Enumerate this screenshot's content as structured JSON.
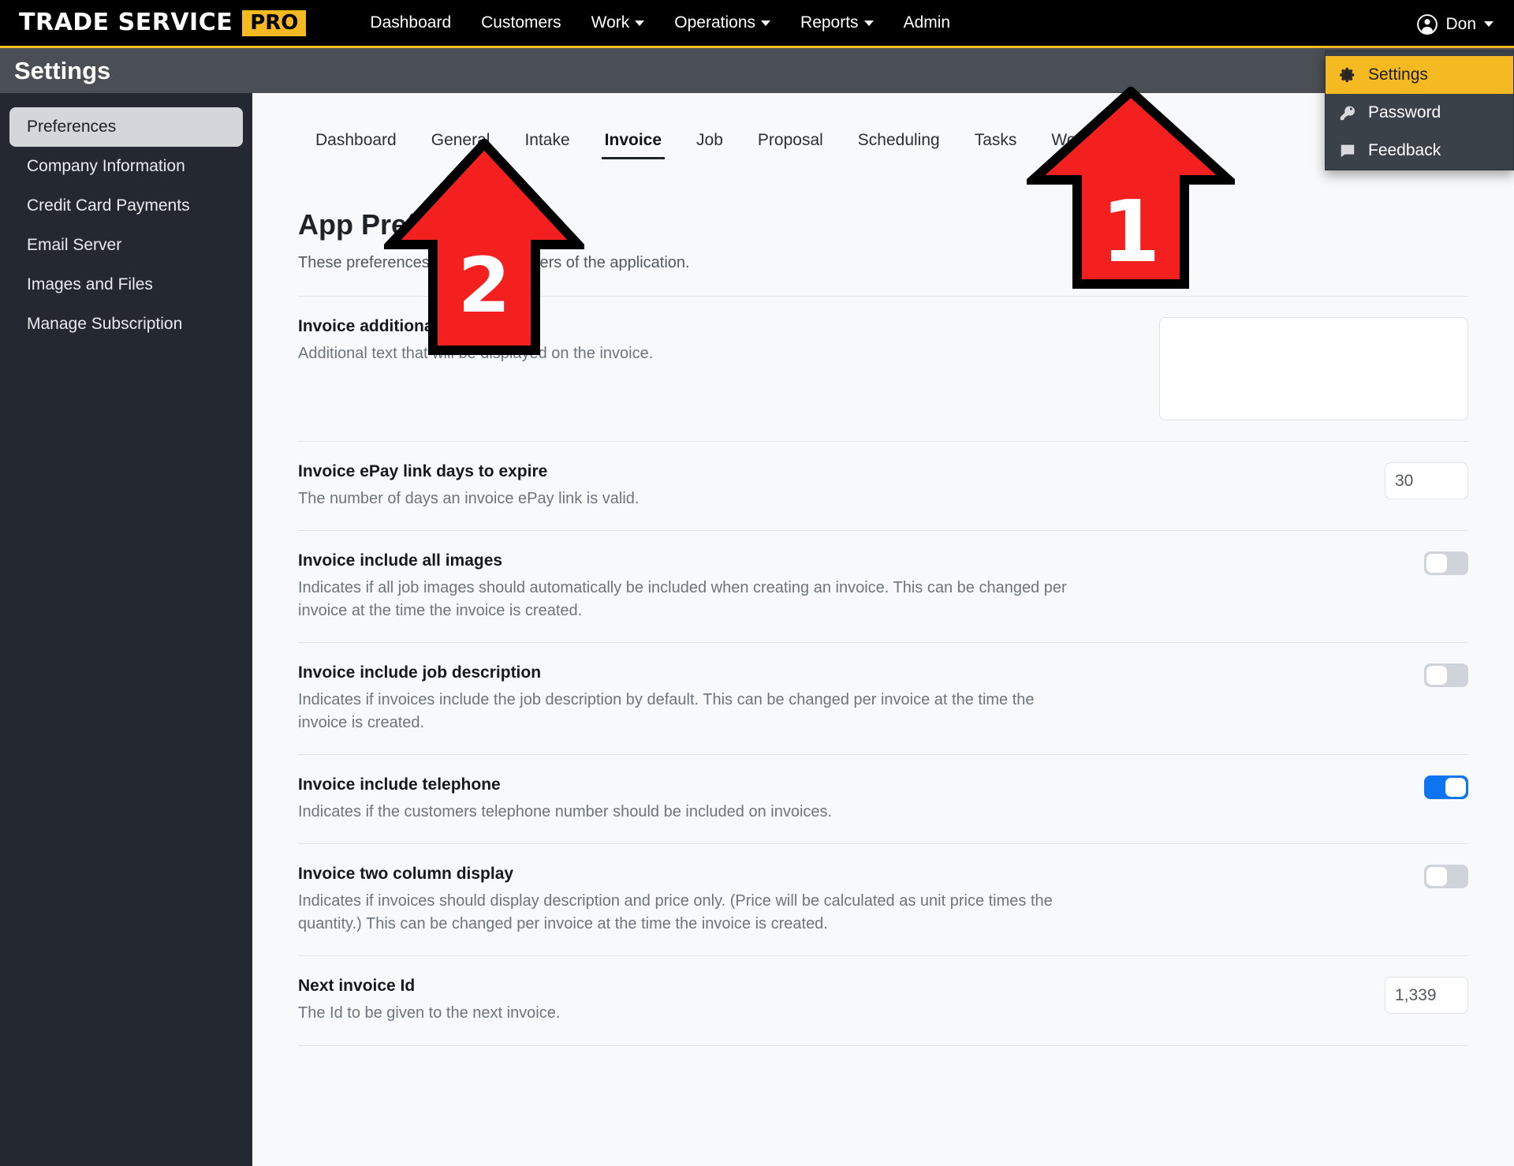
{
  "navbar": {
    "brand_main": "TRADE SERVICE",
    "brand_badge": "PRO",
    "links": [
      {
        "label": "Dashboard",
        "caret": false
      },
      {
        "label": "Customers",
        "caret": false
      },
      {
        "label": "Work",
        "caret": true
      },
      {
        "label": "Operations",
        "caret": true
      },
      {
        "label": "Reports",
        "caret": true
      },
      {
        "label": "Admin",
        "caret": false
      }
    ],
    "user": {
      "name": "Don",
      "avatar_icon": "user-circle-icon",
      "caret_icon": "chevron-down-icon"
    }
  },
  "user_dropdown": {
    "items": [
      {
        "label": "Settings",
        "icon": "gear-icon",
        "active": true
      },
      {
        "label": "Password",
        "icon": "key-icon",
        "active": false
      },
      {
        "label": "Feedback",
        "icon": "comment-icon",
        "active": false
      }
    ]
  },
  "page_header": {
    "title": "Settings"
  },
  "sidebar": {
    "items": [
      {
        "label": "Preferences",
        "active": true
      },
      {
        "label": "Company Information",
        "active": false
      },
      {
        "label": "Credit Card Payments",
        "active": false
      },
      {
        "label": "Email Server",
        "active": false
      },
      {
        "label": "Images and Files",
        "active": false
      },
      {
        "label": "Manage Subscription",
        "active": false
      }
    ]
  },
  "tabs": [
    {
      "label": "Dashboard",
      "active": false
    },
    {
      "label": "General",
      "active": false
    },
    {
      "label": "Intake",
      "active": false
    },
    {
      "label": "Invoice",
      "active": true
    },
    {
      "label": "Job",
      "active": false
    },
    {
      "label": "Proposal",
      "active": false
    },
    {
      "label": "Scheduling",
      "active": false
    },
    {
      "label": "Tasks",
      "active": false
    },
    {
      "label": "Work Order",
      "active": false
    }
  ],
  "main": {
    "heading": "App Preferences",
    "subheading": "These preferences will affect all users of the application.",
    "rows": [
      {
        "label": "Invoice additional text",
        "desc": "Additional text that will be displayed on the invoice.",
        "control": "textarea",
        "value": "",
        "placeholder": ""
      },
      {
        "label": "Invoice ePay link days to expire",
        "desc": "The number of days an invoice ePay link is valid.",
        "control": "number",
        "value": "30"
      },
      {
        "label": "Invoice include all images",
        "desc": "Indicates if all job images should automatically be included when creating an invoice. This can be changed per invoice at the time the invoice is created.",
        "control": "toggle",
        "value": "off"
      },
      {
        "label": "Invoice include job description",
        "desc": "Indicates if invoices include the job description by default. This can be changed per invoice at the time the invoice is created.",
        "control": "toggle",
        "value": "off"
      },
      {
        "label": "Invoice include telephone",
        "desc": "Indicates if the customers telephone number should be included on invoices.",
        "control": "toggle",
        "value": "on"
      },
      {
        "label": "Invoice two column display",
        "desc": "Indicates if invoices should display description and price only. (Price will be calculated as unit price times the quantity.) This can be changed per invoice at the time the invoice is created.",
        "control": "toggle",
        "value": "off"
      },
      {
        "label": "Next invoice Id",
        "desc": "The Id to be given to the next invoice.",
        "control": "number",
        "value": "1,339"
      }
    ]
  },
  "annotations": {
    "arrow_color": "#f42020",
    "arrow_outline": "#000000",
    "items": [
      {
        "number": "1",
        "points_at": "settings-menu-item"
      },
      {
        "number": "2",
        "points_at": "tab-invoice"
      }
    ]
  }
}
